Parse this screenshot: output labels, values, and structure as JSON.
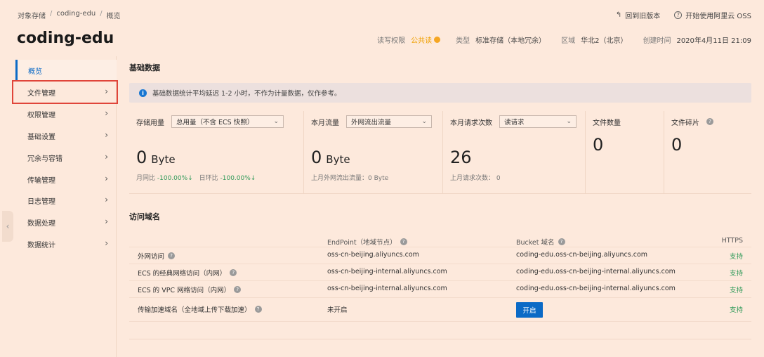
{
  "breadcrumb": [
    "对象存储",
    "coding-edu",
    "概览"
  ],
  "top_actions": {
    "back_old": "回到旧版本",
    "start_oss": "开始使用阿里云 OSS"
  },
  "bucket": {
    "title": "coding-edu",
    "rw_label": "读写权限",
    "rw_value": "公共读",
    "type_label": "类型",
    "type_value": "标准存储（本地冗余）",
    "region_label": "区域",
    "region_value": "华北2（北京）",
    "created_label": "创建时间",
    "created_value": "2020年4月11日 21:09"
  },
  "sidebar": {
    "items": [
      {
        "label": "概览"
      },
      {
        "label": "文件管理"
      },
      {
        "label": "权限管理"
      },
      {
        "label": "基础设置"
      },
      {
        "label": "冗余与容错"
      },
      {
        "label": "传输管理"
      },
      {
        "label": "日志管理"
      },
      {
        "label": "数据处理"
      },
      {
        "label": "数据统计"
      }
    ]
  },
  "basic": {
    "title": "基础数据",
    "notice": "基础数据统计平均延迟 1-2 小时，不作为计量数据，仅作参考。",
    "storage": {
      "label": "存储用量",
      "select": "总用量（不含 ECS 快照）",
      "value": "0",
      "unit": "Byte",
      "mom_label": "月同比",
      "mom_value": "-100.00%",
      "yoy_label": "日环比",
      "yoy_value": "-100.00%"
    },
    "traffic": {
      "label": "本月流量",
      "select": "外网流出流量",
      "value": "0",
      "unit": "Byte",
      "sub": "上月外网流出流量：0 Byte"
    },
    "requests": {
      "label": "本月请求次数",
      "select": "读请求",
      "value": "26",
      "sub": "上月请求次数： 0"
    },
    "files": {
      "label": "文件数量",
      "value": "0"
    },
    "fragments": {
      "label": "文件碎片",
      "value": "0"
    }
  },
  "domains": {
    "title": "访问域名",
    "headers": {
      "endpoint": "EndPoint（地域节点）",
      "bucket_domain": "Bucket 域名",
      "https": "HTTPS"
    },
    "rows": [
      {
        "name": "外网访问",
        "endpoint": "oss-cn-beijing.aliyuncs.com",
        "bucket": "coding-edu.oss-cn-beijing.aliyuncs.com",
        "https": "支持"
      },
      {
        "name": "ECS 的经典网络访问（内网）",
        "endpoint": "oss-cn-beijing-internal.aliyuncs.com",
        "bucket": "coding-edu.oss-cn-beijing-internal.aliyuncs.com",
        "https": "支持"
      },
      {
        "name": "ECS 的 VPC 网络访问（内网）",
        "endpoint": "oss-cn-beijing-internal.aliyuncs.com",
        "bucket": "coding-edu.oss-cn-beijing-internal.aliyuncs.com",
        "https": "支持"
      },
      {
        "name": "传输加速域名（全地域上传下载加速）",
        "endpoint": "未开启",
        "button": "开启",
        "https": "支持"
      }
    ]
  },
  "colors": {
    "accent": "#0b6ac6",
    "highlight": "#e0453a",
    "support": "#2e9a58",
    "badge": "#f5a623"
  }
}
